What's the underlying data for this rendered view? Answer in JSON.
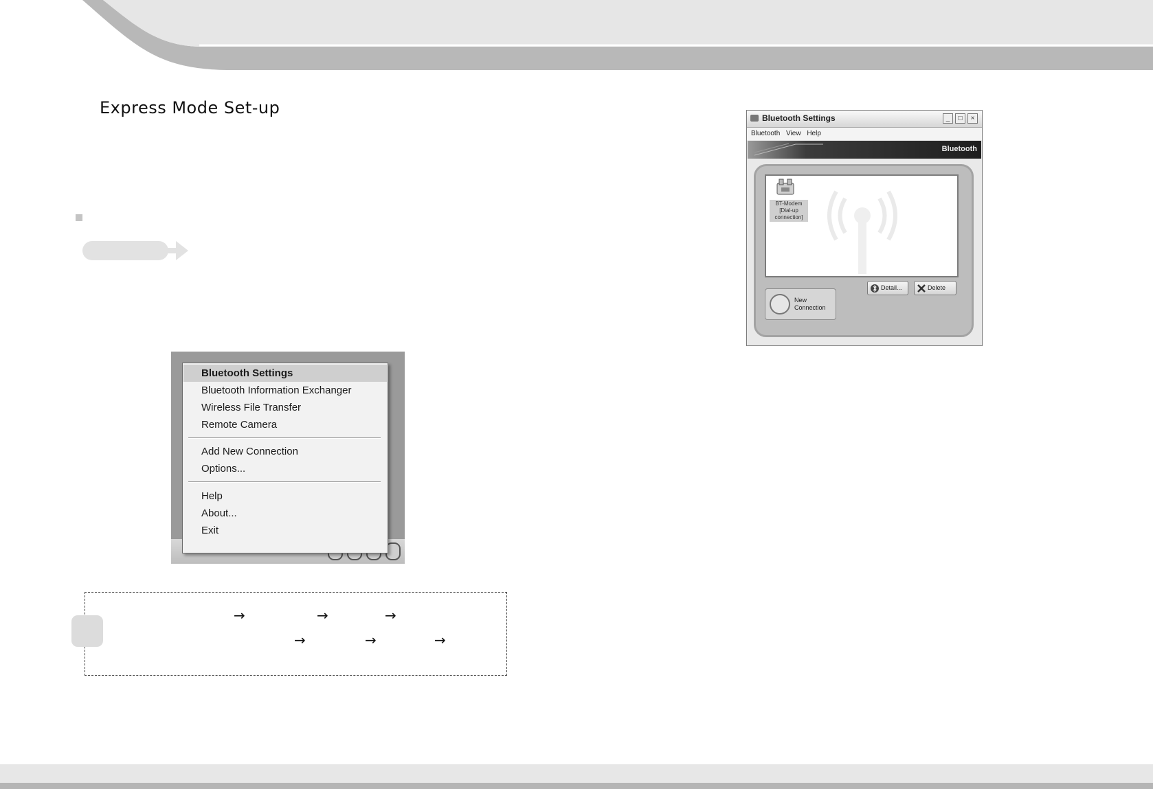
{
  "section_title": "Express Mode Set-up",
  "context_menu": {
    "items": [
      "Bluetooth Settings",
      "Bluetooth Information Exchanger",
      "Wireless File Transfer",
      "Remote Camera",
      "Add New Connection",
      "Options...",
      "Help",
      "About...",
      "Exit"
    ],
    "highlighted_index": 0
  },
  "bt_window": {
    "title": "Bluetooth Settings",
    "menu": [
      "Bluetooth",
      "View",
      "Help"
    ],
    "banner_label": "Bluetooth",
    "device_label": "BT-Modem\n[Dial-up\nconnection]",
    "new_connection_label": "New\nConnection",
    "detail_button": "Detail...",
    "delete_button": "Delete",
    "window_controls": [
      "_",
      "□",
      "×"
    ]
  },
  "note": {
    "arrows": [
      "→",
      "→",
      "→",
      "→",
      "→",
      "→"
    ]
  },
  "colors": {
    "header_light": "#e6e6e6",
    "header_dark": "#b8b8b8",
    "footer": "#e7e7e7"
  }
}
